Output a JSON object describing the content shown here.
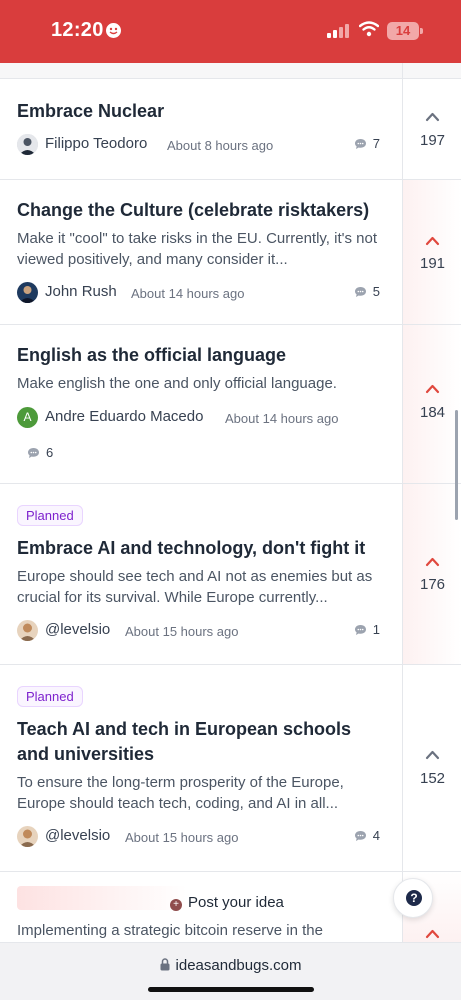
{
  "status_bar": {
    "time": "12:20",
    "battery": "14",
    "color": "#d93d3d"
  },
  "posts": [
    {
      "title": "Embrace Nuclear",
      "description": "",
      "badge": "",
      "author": "Filippo Teodoro",
      "time": "About 8 hours ago",
      "comments": "7",
      "votes": "197",
      "voted": false
    },
    {
      "title": "Change the Culture (celebrate risktakers)",
      "description": "Make it \"cool\" to take risks in the EU. Currently, it's not viewed positively, and many consider it...",
      "badge": "",
      "author": "John Rush",
      "time": "About 14 hours ago",
      "comments": "5",
      "votes": "191",
      "voted": true
    },
    {
      "title": "English as the official language",
      "description": "Make english the one and only official language.",
      "badge": "",
      "author": "Andre Eduardo Macedo",
      "avatar_letter": "A",
      "time": "About 14 hours ago",
      "comments": "6",
      "votes": "184",
      "voted": true
    },
    {
      "title": "Embrace AI and technology, don't fight it",
      "description": "Europe should see tech and AI not as enemies but as crucial for its survival. While Europe currently...",
      "badge": "Planned",
      "author": "@levelsio",
      "time": "About 15 hours ago",
      "comments": "1",
      "votes": "176",
      "voted": true
    },
    {
      "title": "Teach AI and tech in European schools and universities",
      "description": "To ensure the long-term prosperity of the Europe, Europe should teach tech, coding, and AI in all...",
      "badge": "Planned",
      "author": "@levelsio",
      "time": "About 15 hours ago",
      "comments": "4",
      "votes": "152",
      "voted": false
    }
  ],
  "cta": {
    "post_idea": "Post your idea",
    "partial_text": "Implementing a strategic bitcoin reserve in the",
    "help": "?"
  },
  "browser": {
    "url": "ideasandbugs.com"
  },
  "colors": {
    "accent": "#e0483e",
    "badge_purple": "#7e22ce",
    "vote_inactive": "#6b7280"
  }
}
